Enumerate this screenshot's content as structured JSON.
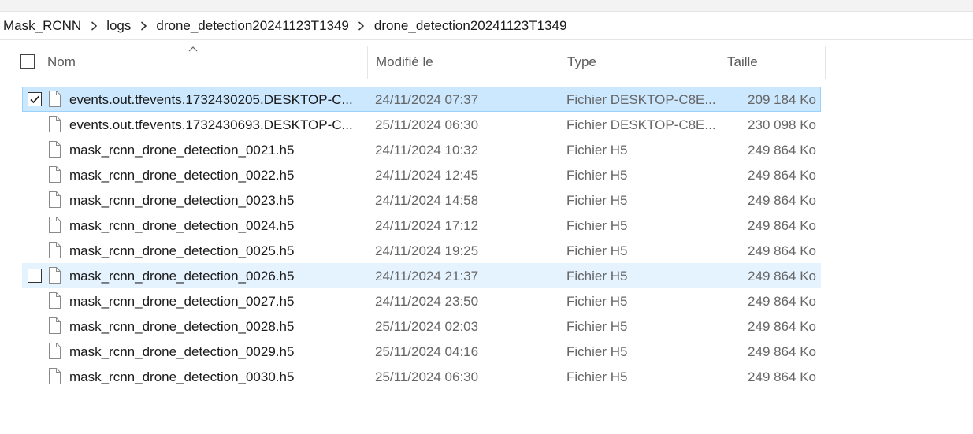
{
  "breadcrumb": [
    "Mask_RCNN",
    "logs",
    "drone_detection20241123T1349",
    "drone_detection20241123T1349"
  ],
  "columns": {
    "name": "Nom",
    "modified": "Modifié le",
    "type": "Type",
    "size": "Taille"
  },
  "rows": [
    {
      "name": "events.out.tfevents.1732430205.DESKTOP-C...",
      "modified": "24/11/2024 07:37",
      "type": "Fichier DESKTOP-C8E...",
      "size": "209 184 Ko",
      "state": "selected"
    },
    {
      "name": "events.out.tfevents.1732430693.DESKTOP-C...",
      "modified": "25/11/2024 06:30",
      "type": "Fichier DESKTOP-C8E...",
      "size": "230 098 Ko",
      "state": ""
    },
    {
      "name": "mask_rcnn_drone_detection_0021.h5",
      "modified": "24/11/2024 10:32",
      "type": "Fichier H5",
      "size": "249 864 Ko",
      "state": ""
    },
    {
      "name": "mask_rcnn_drone_detection_0022.h5",
      "modified": "24/11/2024 12:45",
      "type": "Fichier H5",
      "size": "249 864 Ko",
      "state": ""
    },
    {
      "name": "mask_rcnn_drone_detection_0023.h5",
      "modified": "24/11/2024 14:58",
      "type": "Fichier H5",
      "size": "249 864 Ko",
      "state": ""
    },
    {
      "name": "mask_rcnn_drone_detection_0024.h5",
      "modified": "24/11/2024 17:12",
      "type": "Fichier H5",
      "size": "249 864 Ko",
      "state": ""
    },
    {
      "name": "mask_rcnn_drone_detection_0025.h5",
      "modified": "24/11/2024 19:25",
      "type": "Fichier H5",
      "size": "249 864 Ko",
      "state": ""
    },
    {
      "name": "mask_rcnn_drone_detection_0026.h5",
      "modified": "24/11/2024 21:37",
      "type": "Fichier H5",
      "size": "249 864 Ko",
      "state": "hover"
    },
    {
      "name": "mask_rcnn_drone_detection_0027.h5",
      "modified": "24/11/2024 23:50",
      "type": "Fichier H5",
      "size": "249 864 Ko",
      "state": ""
    },
    {
      "name": "mask_rcnn_drone_detection_0028.h5",
      "modified": "25/11/2024 02:03",
      "type": "Fichier H5",
      "size": "249 864 Ko",
      "state": ""
    },
    {
      "name": "mask_rcnn_drone_detection_0029.h5",
      "modified": "25/11/2024 04:16",
      "type": "Fichier H5",
      "size": "249 864 Ko",
      "state": ""
    },
    {
      "name": "mask_rcnn_drone_detection_0030.h5",
      "modified": "25/11/2024 06:30",
      "type": "Fichier H5",
      "size": "249 864 Ko",
      "state": ""
    }
  ],
  "icons": {
    "file": "file-icon",
    "separator": "chevron-right-icon",
    "sort": "sort-up-icon",
    "check": "checkmark-icon"
  },
  "colors": {
    "selected_bg": "#cce8ff",
    "selected_border": "#99d1ff",
    "hover_bg": "#e5f3ff"
  }
}
